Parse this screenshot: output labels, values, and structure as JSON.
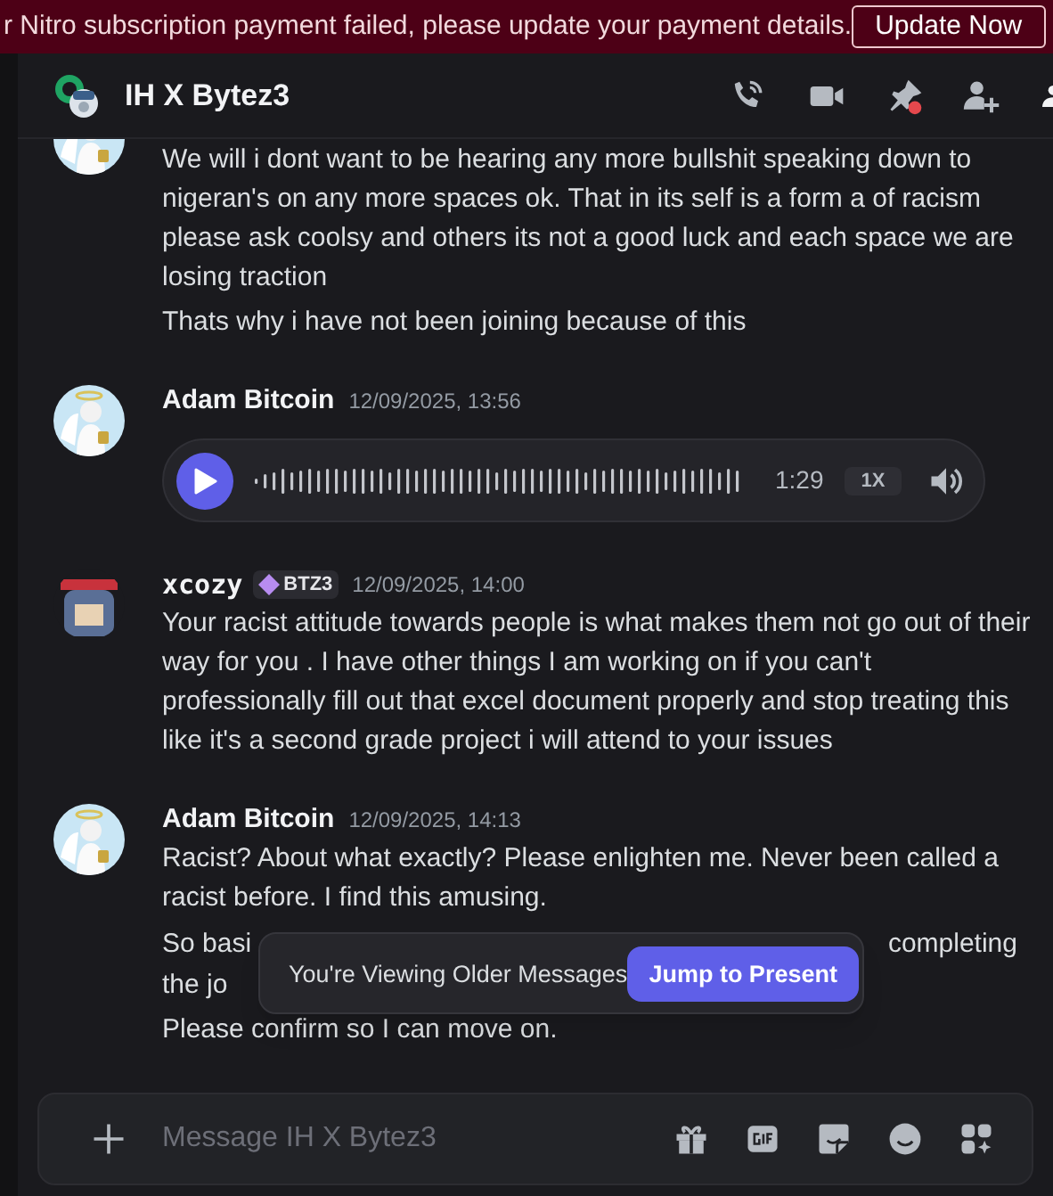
{
  "banner": {
    "text": "r Nitro subscription payment failed, please update your payment details.",
    "button": "Update Now"
  },
  "header": {
    "title": "IH X Bytez3"
  },
  "messages": [
    {
      "kind": "text",
      "paragraphs": [
        {
          "text": "We will i dont want to be hearing any more bullshit speaking down to nigeran's on any more spaces ok. That in its self is a form a of racism please ask coolsy and others its not a good luck and each space we are losing traction"
        },
        {
          "text": "Thats why i have not been joining because of this"
        }
      ]
    },
    {
      "kind": "voice",
      "author": "Adam Bitcoin",
      "timestamp": "12/09/2025, 13:56",
      "duration": "1:29",
      "speed": "1X"
    },
    {
      "kind": "text",
      "author": "xcozy",
      "badge": "BTZ3",
      "timestamp": "12/09/2025, 14:00",
      "paragraphs": [
        {
          "text": "Your racist attitude  towards people is what makes them not go out of their way for you . I have other things I am working on if you can't professionally fill out that excel document properly and stop treating this like it's a second grade project i will attend to your issues"
        }
      ]
    },
    {
      "kind": "text",
      "author": "Adam Bitcoin",
      "timestamp": "12/09/2025, 14:13",
      "paragraphs": [
        {
          "text": "Racist? About what exactly? Please enlighten me. Never been called a racist before. I find this amusing."
        },
        {
          "lines": [
            [
              "So basi",
              "completing"
            ],
            [
              "the jo"
            ]
          ]
        },
        {
          "text": "Please confirm so I can move on."
        }
      ]
    }
  ],
  "toast": {
    "text": "You're Viewing Older Messages",
    "button": "Jump to Present"
  },
  "composer": {
    "placeholder": "Message IH X Bytez3"
  }
}
